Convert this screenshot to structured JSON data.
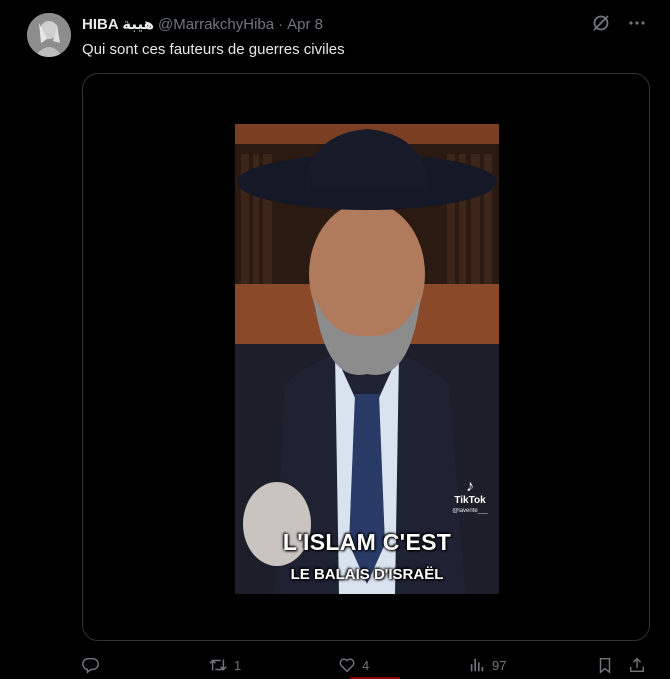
{
  "tweet": {
    "author_name": "HIBA هيبة",
    "handle": "@MarrakchyHiba",
    "separator": "·",
    "date": "Apr 8",
    "text": "Qui sont ces fauteurs de guerres civiles"
  },
  "video": {
    "watermark_title": "TikTok",
    "watermark_user": "@laverite___",
    "caption_line1": "L'ISLAM C'EST",
    "caption_line2": "LE BALAIS D'ISRAËL"
  },
  "actions": {
    "reply_count": "",
    "retweet_count": "1",
    "like_count": "4",
    "views_count": "97"
  },
  "icons": {
    "grok": "grok-icon",
    "more": "more-icon",
    "reply": "reply-icon",
    "retweet": "retweet-icon",
    "like": "like-icon",
    "views": "views-icon",
    "bookmark": "bookmark-icon",
    "share": "share-icon"
  },
  "colors": {
    "background": "#000000",
    "text_primary": "#e7e9ea",
    "text_secondary": "#71767b",
    "border": "#2f3336"
  }
}
